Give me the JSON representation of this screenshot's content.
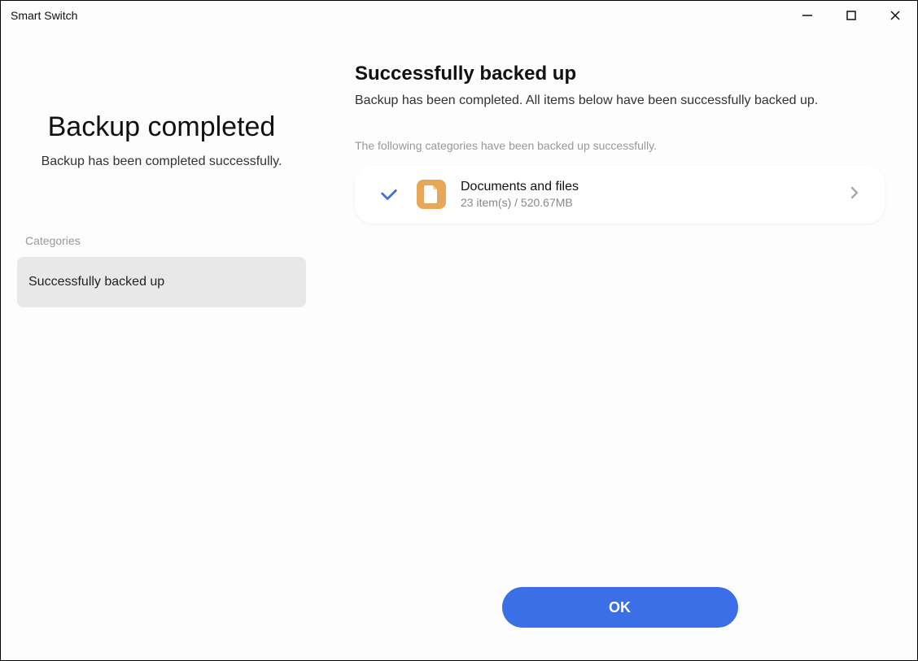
{
  "window": {
    "title": "Smart Switch"
  },
  "sidebar": {
    "title": "Backup completed",
    "subtitle": "Backup has been completed successfully.",
    "categories_label": "Categories",
    "items": [
      {
        "label": "Successfully backed up"
      }
    ]
  },
  "main": {
    "title": "Successfully backed up",
    "subtitle": "Backup has been completed. All items below have been successfully backed up.",
    "list_label": "The following categories have been backed up successfully.",
    "items": [
      {
        "title": "Documents and files",
        "subtitle": "23 item(s) / 520.67MB"
      }
    ]
  },
  "footer": {
    "ok_label": "OK"
  },
  "colors": {
    "accent": "#3b6fe8",
    "doc_icon": "#e6a758"
  }
}
